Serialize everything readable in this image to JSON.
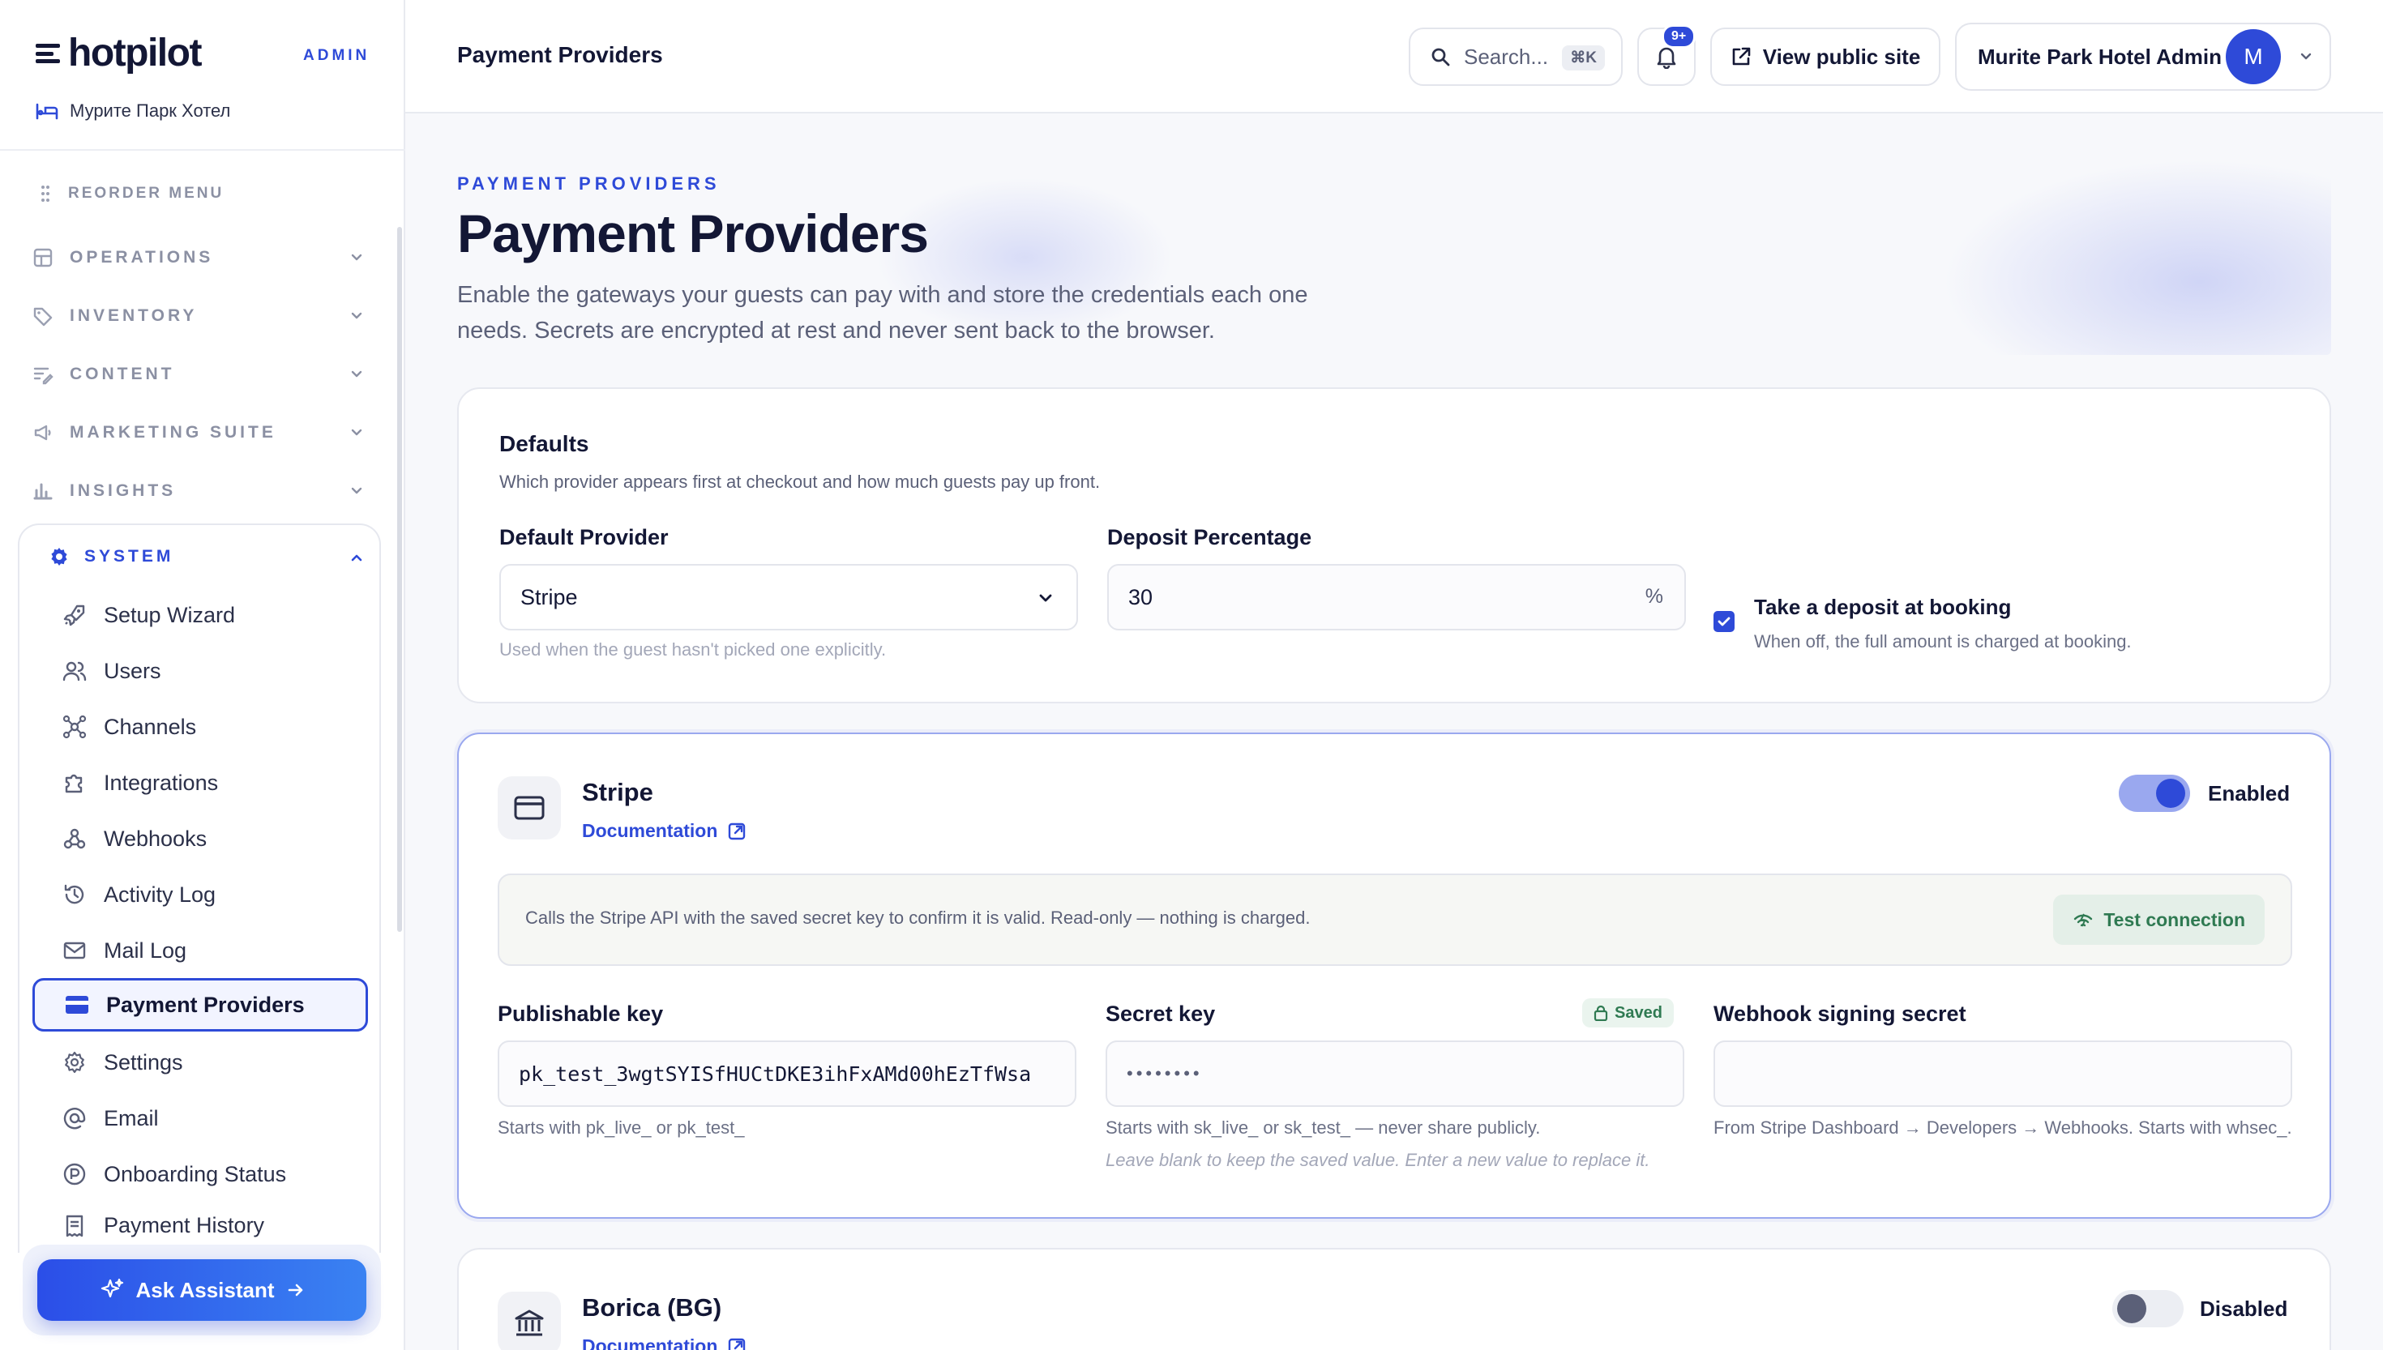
{
  "brand": {
    "name": "hotpilot",
    "tag": "ADMIN",
    "hotel": "Мурите Парк Хотел"
  },
  "sidebar": {
    "reorder": "REORDER MENU",
    "groups": [
      {
        "label": "OPERATIONS",
        "icon": "grid-icon"
      },
      {
        "label": "INVENTORY",
        "icon": "tag-icon"
      },
      {
        "label": "CONTENT",
        "icon": "text-edit-icon"
      },
      {
        "label": "MARKETING SUITE",
        "icon": "megaphone-icon"
      },
      {
        "label": "INSIGHTS",
        "icon": "bar-chart-icon"
      }
    ],
    "system": {
      "label": "SYSTEM",
      "items": [
        {
          "label": "Setup Wizard",
          "icon": "rocket-icon"
        },
        {
          "label": "Users",
          "icon": "users-icon"
        },
        {
          "label": "Channels",
          "icon": "network-icon"
        },
        {
          "label": "Integrations",
          "icon": "puzzle-icon"
        },
        {
          "label": "Webhooks",
          "icon": "webhook-icon"
        },
        {
          "label": "Activity Log",
          "icon": "history-icon"
        },
        {
          "label": "Mail Log",
          "icon": "mail-icon"
        },
        {
          "label": "Payment Providers",
          "icon": "credit-card-icon",
          "active": true
        },
        {
          "label": "Settings",
          "icon": "gear-icon"
        },
        {
          "label": "Email",
          "icon": "at-sign-icon"
        },
        {
          "label": "Onboarding Status",
          "icon": "onboarding-icon"
        },
        {
          "label": "Payment History",
          "icon": "receipt-icon"
        }
      ]
    },
    "assistant": "Ask Assistant"
  },
  "topbar": {
    "breadcrumb": "Payment Providers",
    "search_placeholder": "Search...",
    "search_shortcut": "⌘K",
    "notifications_badge": "9+",
    "view_site": "View public site",
    "account_name": "Murite Park Hotel Admin",
    "avatar_initial": "M"
  },
  "page": {
    "eyebrow": "PAYMENT PROVIDERS",
    "title": "Payment Providers",
    "subtitle": "Enable the gateways your guests can pay with and store the credentials each one needs. Secrets are encrypted at rest and never sent back to the browser."
  },
  "defaults": {
    "title": "Defaults",
    "subtitle": "Which provider appears first at checkout and how much guests pay up front.",
    "provider_label": "Default Provider",
    "provider_value": "Stripe",
    "provider_hint": "Used when the guest hasn't picked one explicitly.",
    "deposit_label": "Deposit Percentage",
    "deposit_value": "30",
    "deposit_unit": "%",
    "take_deposit_label": "Take a deposit at booking",
    "take_deposit_hint": "When off, the full amount is charged at booking.",
    "take_deposit_checked": true
  },
  "stripe": {
    "name": "Stripe",
    "doc_link": "Documentation",
    "enabled": true,
    "status_label": "Enabled",
    "test_text": "Calls the Stripe API with the saved secret key to confirm it is valid. Read-only — nothing is charged.",
    "test_button": "Test connection",
    "publishable_label": "Publishable key",
    "publishable_value": "pk_test_3wgtSYISfHUCtDKE3ihFxAMd00hEzTfWsa",
    "publishable_hint": "Starts with pk_live_ or pk_test_",
    "secret_label": "Secret key",
    "secret_badge": "Saved",
    "secret_value": "••••••••",
    "secret_hint": "Starts with sk_live_ or sk_test_ — never share publicly.",
    "secret_hint2": "Leave blank to keep the saved value. Enter a new value to replace it.",
    "webhook_label": "Webhook signing secret",
    "webhook_value": "",
    "webhook_hint": "From Stripe Dashboard → Developers → Webhooks. Starts with whsec_."
  },
  "borica": {
    "name": "Borica (BG)",
    "doc_link": "Documentation",
    "enabled": false,
    "status_label": "Disabled"
  },
  "colors": {
    "accent": "#2e4ad8",
    "success": "#2f7a52",
    "text": "#131735",
    "muted": "#5b6078"
  }
}
